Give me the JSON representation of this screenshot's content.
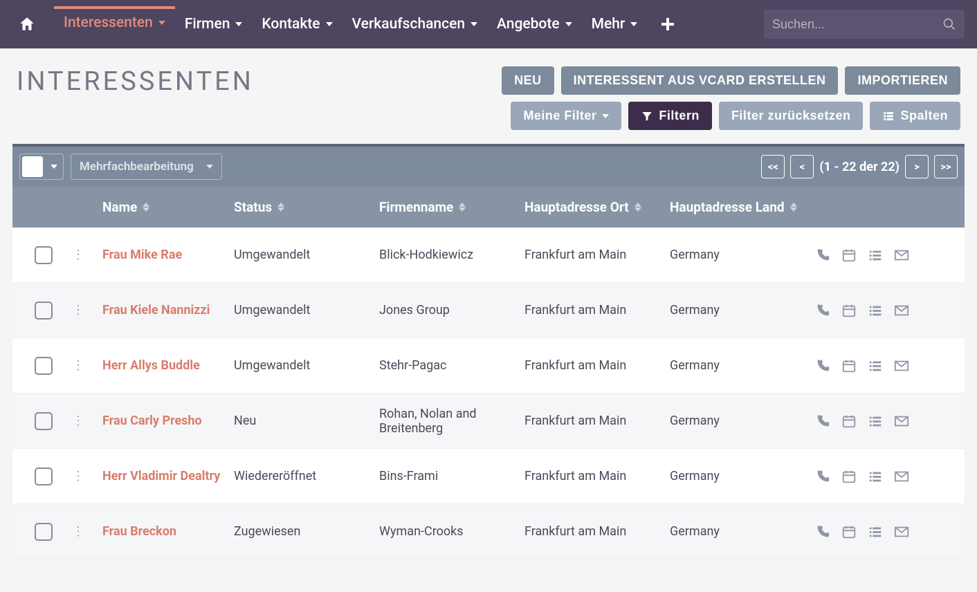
{
  "nav": {
    "items": [
      {
        "label": "Interessenten",
        "active": true
      },
      {
        "label": "Firmen"
      },
      {
        "label": "Kontakte"
      },
      {
        "label": "Verkaufschancen"
      },
      {
        "label": "Angebote"
      },
      {
        "label": "Mehr"
      }
    ],
    "search_placeholder": "Suchen..."
  },
  "page": {
    "title": "Interessenten",
    "buttons": {
      "new": "NEU",
      "vcard": "INTERESSENT AUS VCARD ERSTELLEN",
      "import": "IMPORTIEREN",
      "my_filters": "Meine Filter",
      "filter": "Filtern",
      "reset_filter": "Filter zurücksetzen",
      "columns": "Spalten"
    }
  },
  "toolbar": {
    "multi_edit": "Mehrfachbearbeitung",
    "pager_first": "<<",
    "pager_prev": "<",
    "pager_range": "(1 - 22 der 22)",
    "pager_next": ">",
    "pager_last": ">>"
  },
  "table": {
    "columns": {
      "name": "Name",
      "status": "Status",
      "firm": "Firmenname",
      "city": "Hauptadresse Ort",
      "country": "Hauptadresse Land"
    },
    "rows": [
      {
        "name": "Frau Mike Rae",
        "status": "Umgewandelt",
        "firm": "Blick-Hodkiewicz",
        "city": "Frankfurt am Main",
        "country": "Germany"
      },
      {
        "name": "Frau Kiele Nannizzi",
        "status": "Umgewandelt",
        "firm": "Jones Group",
        "city": "Frankfurt am Main",
        "country": "Germany"
      },
      {
        "name": "Herr Allys Buddle",
        "status": "Umgewandelt",
        "firm": "Stehr-Pagac",
        "city": "Frankfurt am Main",
        "country": "Germany"
      },
      {
        "name": "Frau Carly Presho",
        "status": "Neu",
        "firm": "Rohan, Nolan and Breitenberg",
        "city": "Frankfurt am Main",
        "country": "Germany"
      },
      {
        "name": "Herr Vladimir Dealtry",
        "status": "Wiedereröffnet",
        "firm": "Bins-Frami",
        "city": "Frankfurt am Main",
        "country": "Germany"
      },
      {
        "name": "Frau Breckon",
        "status": "Zugewiesen",
        "firm": "Wyman-Crooks",
        "city": "Frankfurt am Main",
        "country": "Germany"
      }
    ]
  }
}
